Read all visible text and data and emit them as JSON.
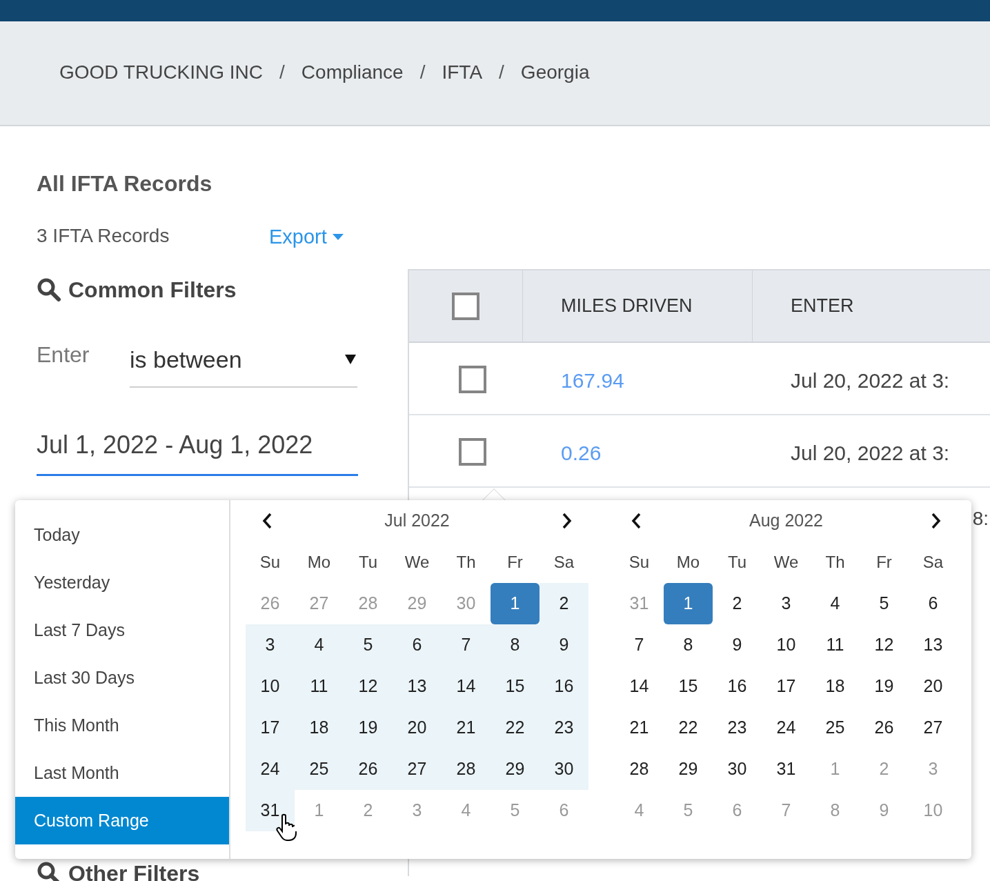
{
  "breadcrumbs": [
    {
      "label": "GOOD TRUCKING INC",
      "separator": "/"
    },
    {
      "label": "Compliance",
      "separator": "/"
    },
    {
      "label": "IFTA",
      "separator": "/"
    },
    {
      "label": "Georgia"
    }
  ],
  "title": "All IFTA Records",
  "record_count": "3 IFTA Records",
  "export_label": "Export",
  "filters": {
    "heading": "Common Filters",
    "field_label": "Enter",
    "operator": "is between",
    "date_range": "Jul 1, 2022 - Aug 1, 2022",
    "other_heading": "Other Filters"
  },
  "table": {
    "header_checked": false,
    "columns": [
      "MILES DRIVEN",
      "ENTER"
    ],
    "rows": [
      {
        "checked": false,
        "miles": "167.94",
        "enter": "Jul 20, 2022 at 3:"
      },
      {
        "checked": false,
        "miles": "0.26",
        "enter": "Jul 20, 2022 at 3:"
      }
    ],
    "peek_text": "8:"
  },
  "ranges": [
    {
      "label": "Today",
      "selected": false
    },
    {
      "label": "Yesterday",
      "selected": false
    },
    {
      "label": "Last 7 Days",
      "selected": false
    },
    {
      "label": "Last 30 Days",
      "selected": false
    },
    {
      "label": "This Month",
      "selected": false
    },
    {
      "label": "Last Month",
      "selected": false
    },
    {
      "label": "Custom Range",
      "selected": true
    }
  ],
  "calendars": [
    {
      "month": "Jul 2022",
      "weekdays": [
        "Su",
        "Mo",
        "Tu",
        "We",
        "Th",
        "Fr",
        "Sa"
      ],
      "weeks": [
        [
          {
            "d": "26",
            "muted": true,
            "in_range": false,
            "selected": false
          },
          {
            "d": "27",
            "muted": true,
            "in_range": false,
            "selected": false
          },
          {
            "d": "28",
            "muted": true,
            "in_range": false,
            "selected": false
          },
          {
            "d": "29",
            "muted": true,
            "in_range": false,
            "selected": false
          },
          {
            "d": "30",
            "muted": true,
            "in_range": false,
            "selected": false
          },
          {
            "d": "1",
            "muted": false,
            "in_range": false,
            "selected": true
          },
          {
            "d": "2",
            "muted": false,
            "in_range": true,
            "selected": false
          }
        ],
        [
          {
            "d": "3",
            "muted": false,
            "in_range": true,
            "selected": false
          },
          {
            "d": "4",
            "muted": false,
            "in_range": true,
            "selected": false
          },
          {
            "d": "5",
            "muted": false,
            "in_range": true,
            "selected": false
          },
          {
            "d": "6",
            "muted": false,
            "in_range": true,
            "selected": false
          },
          {
            "d": "7",
            "muted": false,
            "in_range": true,
            "selected": false
          },
          {
            "d": "8",
            "muted": false,
            "in_range": true,
            "selected": false
          },
          {
            "d": "9",
            "muted": false,
            "in_range": true,
            "selected": false
          }
        ],
        [
          {
            "d": "10",
            "muted": false,
            "in_range": true,
            "selected": false
          },
          {
            "d": "11",
            "muted": false,
            "in_range": true,
            "selected": false
          },
          {
            "d": "12",
            "muted": false,
            "in_range": true,
            "selected": false
          },
          {
            "d": "13",
            "muted": false,
            "in_range": true,
            "selected": false
          },
          {
            "d": "14",
            "muted": false,
            "in_range": true,
            "selected": false
          },
          {
            "d": "15",
            "muted": false,
            "in_range": true,
            "selected": false
          },
          {
            "d": "16",
            "muted": false,
            "in_range": true,
            "selected": false
          }
        ],
        [
          {
            "d": "17",
            "muted": false,
            "in_range": true,
            "selected": false
          },
          {
            "d": "18",
            "muted": false,
            "in_range": true,
            "selected": false
          },
          {
            "d": "19",
            "muted": false,
            "in_range": true,
            "selected": false
          },
          {
            "d": "20",
            "muted": false,
            "in_range": true,
            "selected": false
          },
          {
            "d": "21",
            "muted": false,
            "in_range": true,
            "selected": false
          },
          {
            "d": "22",
            "muted": false,
            "in_range": true,
            "selected": false
          },
          {
            "d": "23",
            "muted": false,
            "in_range": true,
            "selected": false
          }
        ],
        [
          {
            "d": "24",
            "muted": false,
            "in_range": true,
            "selected": false
          },
          {
            "d": "25",
            "muted": false,
            "in_range": true,
            "selected": false
          },
          {
            "d": "26",
            "muted": false,
            "in_range": true,
            "selected": false
          },
          {
            "d": "27",
            "muted": false,
            "in_range": true,
            "selected": false
          },
          {
            "d": "28",
            "muted": false,
            "in_range": true,
            "selected": false
          },
          {
            "d": "29",
            "muted": false,
            "in_range": true,
            "selected": false
          },
          {
            "d": "30",
            "muted": false,
            "in_range": true,
            "selected": false
          }
        ],
        [
          {
            "d": "31",
            "muted": false,
            "in_range": true,
            "selected": false,
            "hovered": true
          },
          {
            "d": "1",
            "muted": true,
            "in_range": false,
            "selected": false
          },
          {
            "d": "2",
            "muted": true,
            "in_range": false,
            "selected": false
          },
          {
            "d": "3",
            "muted": true,
            "in_range": false,
            "selected": false
          },
          {
            "d": "4",
            "muted": true,
            "in_range": false,
            "selected": false
          },
          {
            "d": "5",
            "muted": true,
            "in_range": false,
            "selected": false
          },
          {
            "d": "6",
            "muted": true,
            "in_range": false,
            "selected": false
          }
        ]
      ]
    },
    {
      "month": "Aug 2022",
      "weekdays": [
        "Su",
        "Mo",
        "Tu",
        "We",
        "Th",
        "Fr",
        "Sa"
      ],
      "weeks": [
        [
          {
            "d": "31",
            "muted": true,
            "in_range": false,
            "selected": false
          },
          {
            "d": "1",
            "muted": false,
            "in_range": false,
            "selected": true
          },
          {
            "d": "2",
            "muted": false,
            "in_range": false,
            "selected": false
          },
          {
            "d": "3",
            "muted": false,
            "in_range": false,
            "selected": false
          },
          {
            "d": "4",
            "muted": false,
            "in_range": false,
            "selected": false
          },
          {
            "d": "5",
            "muted": false,
            "in_range": false,
            "selected": false
          },
          {
            "d": "6",
            "muted": false,
            "in_range": false,
            "selected": false
          }
        ],
        [
          {
            "d": "7",
            "muted": false,
            "in_range": false,
            "selected": false
          },
          {
            "d": "8",
            "muted": false,
            "in_range": false,
            "selected": false
          },
          {
            "d": "9",
            "muted": false,
            "in_range": false,
            "selected": false
          },
          {
            "d": "10",
            "muted": false,
            "in_range": false,
            "selected": false
          },
          {
            "d": "11",
            "muted": false,
            "in_range": false,
            "selected": false
          },
          {
            "d": "12",
            "muted": false,
            "in_range": false,
            "selected": false
          },
          {
            "d": "13",
            "muted": false,
            "in_range": false,
            "selected": false
          }
        ],
        [
          {
            "d": "14",
            "muted": false,
            "in_range": false,
            "selected": false
          },
          {
            "d": "15",
            "muted": false,
            "in_range": false,
            "selected": false
          },
          {
            "d": "16",
            "muted": false,
            "in_range": false,
            "selected": false
          },
          {
            "d": "17",
            "muted": false,
            "in_range": false,
            "selected": false
          },
          {
            "d": "18",
            "muted": false,
            "in_range": false,
            "selected": false
          },
          {
            "d": "19",
            "muted": false,
            "in_range": false,
            "selected": false
          },
          {
            "d": "20",
            "muted": false,
            "in_range": false,
            "selected": false
          }
        ],
        [
          {
            "d": "21",
            "muted": false,
            "in_range": false,
            "selected": false
          },
          {
            "d": "22",
            "muted": false,
            "in_range": false,
            "selected": false
          },
          {
            "d": "23",
            "muted": false,
            "in_range": false,
            "selected": false
          },
          {
            "d": "24",
            "muted": false,
            "in_range": false,
            "selected": false
          },
          {
            "d": "25",
            "muted": false,
            "in_range": false,
            "selected": false
          },
          {
            "d": "26",
            "muted": false,
            "in_range": false,
            "selected": false
          },
          {
            "d": "27",
            "muted": false,
            "in_range": false,
            "selected": false
          }
        ],
        [
          {
            "d": "28",
            "muted": false,
            "in_range": false,
            "selected": false
          },
          {
            "d": "29",
            "muted": false,
            "in_range": false,
            "selected": false
          },
          {
            "d": "30",
            "muted": false,
            "in_range": false,
            "selected": false
          },
          {
            "d": "31",
            "muted": false,
            "in_range": false,
            "selected": false
          },
          {
            "d": "1",
            "muted": true,
            "in_range": false,
            "selected": false
          },
          {
            "d": "2",
            "muted": true,
            "in_range": false,
            "selected": false
          },
          {
            "d": "3",
            "muted": true,
            "in_range": false,
            "selected": false
          }
        ],
        [
          {
            "d": "4",
            "muted": true,
            "in_range": false,
            "selected": false
          },
          {
            "d": "5",
            "muted": true,
            "in_range": false,
            "selected": false
          },
          {
            "d": "6",
            "muted": true,
            "in_range": false,
            "selected": false
          },
          {
            "d": "7",
            "muted": true,
            "in_range": false,
            "selected": false
          },
          {
            "d": "8",
            "muted": true,
            "in_range": false,
            "selected": false
          },
          {
            "d": "9",
            "muted": true,
            "in_range": false,
            "selected": false
          },
          {
            "d": "10",
            "muted": true,
            "in_range": false,
            "selected": false
          }
        ]
      ]
    }
  ]
}
